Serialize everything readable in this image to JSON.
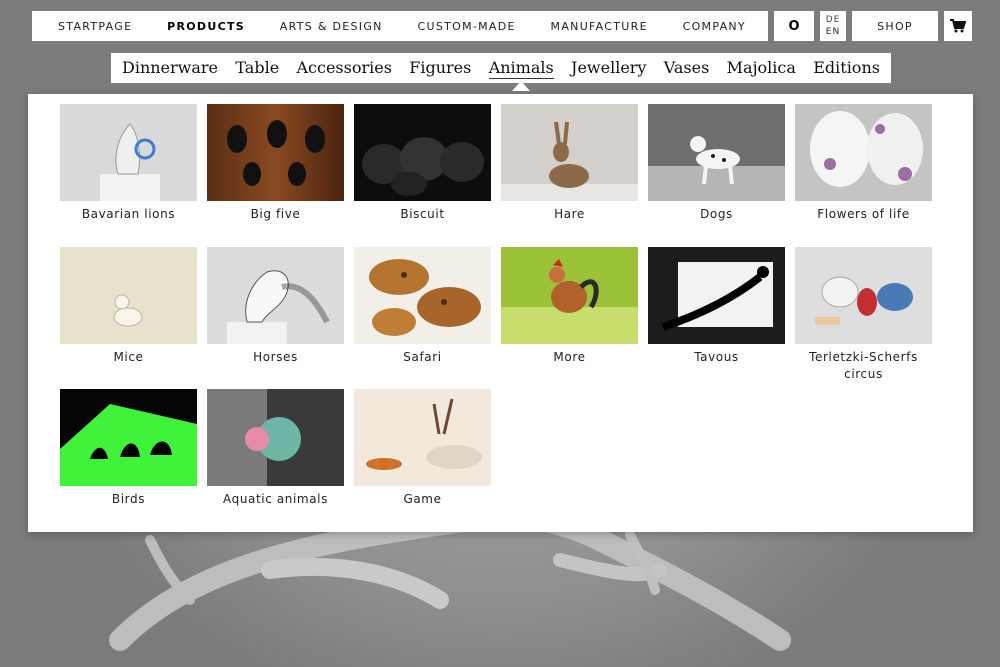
{
  "nav": {
    "items": [
      "STARTPAGE",
      "PRODUCTS",
      "ARTS & DESIGN",
      "CUSTOM-MADE",
      "MANUFACTURE",
      "COMPANY"
    ],
    "active": "PRODUCTS",
    "o_label": "O",
    "lang": [
      "DE",
      "EN"
    ],
    "current_lang": "EN",
    "shop_label": "SHOP",
    "cart_icon": "shopping-cart-icon"
  },
  "subnav": {
    "items": [
      "Dinnerware",
      "Table",
      "Accessories",
      "Figures",
      "Animals",
      "Jewellery",
      "Vases",
      "Majolica",
      "Editions"
    ],
    "active": "Animals"
  },
  "categories": [
    {
      "label": "Bavarian lions"
    },
    {
      "label": "Big five"
    },
    {
      "label": "Biscuit"
    },
    {
      "label": "Hare"
    },
    {
      "label": "Dogs"
    },
    {
      "label": "Flowers of life"
    },
    {
      "label": "Mice"
    },
    {
      "label": "Horses"
    },
    {
      "label": "Safari"
    },
    {
      "label": "More"
    },
    {
      "label": "Tavous"
    },
    {
      "label": "Terletzki-Scherfs circus"
    },
    {
      "label": "Birds"
    },
    {
      "label": "Aquatic animals"
    },
    {
      "label": "Game"
    }
  ],
  "colors": {
    "background": "#8e8e8e",
    "panel": "#ffffff",
    "text": "#222222"
  }
}
